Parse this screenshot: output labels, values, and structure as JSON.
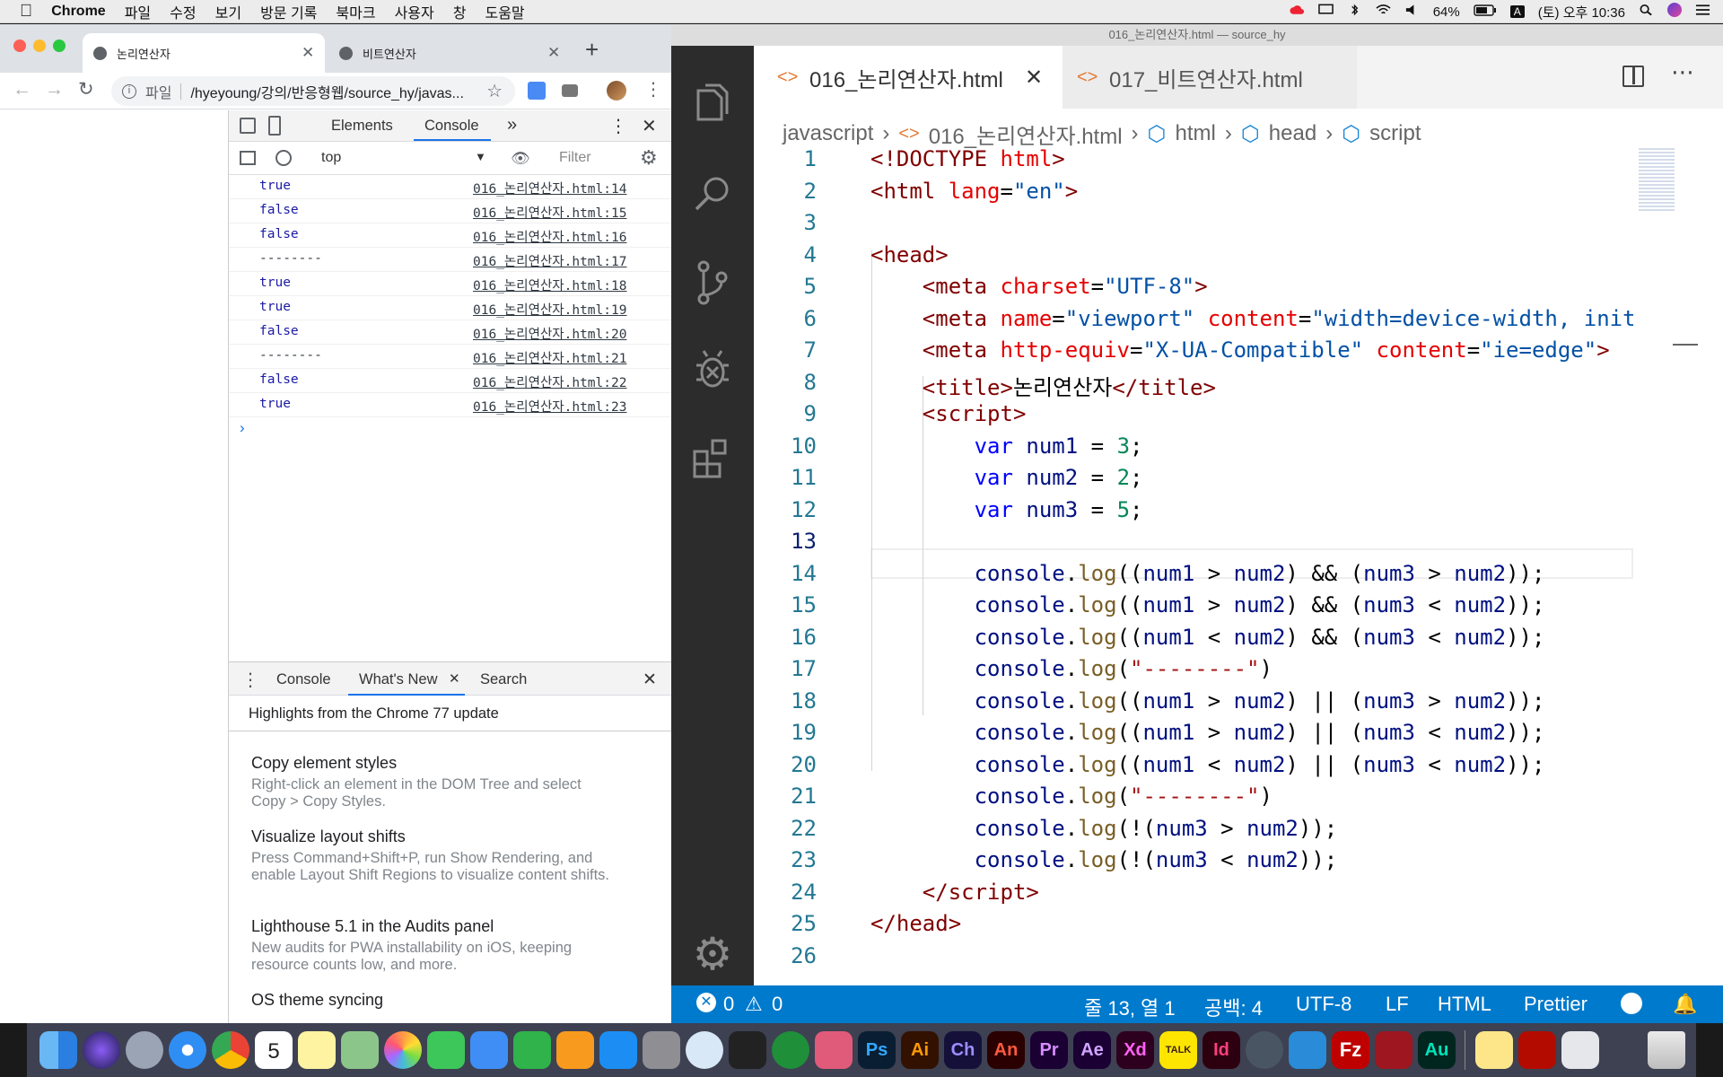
{
  "menubar": {
    "app": "Chrome",
    "items": [
      "파일",
      "수정",
      "보기",
      "방문 기록",
      "북마크",
      "사용자",
      "창",
      "도움말"
    ],
    "battery": "64%",
    "input_source": "A",
    "clock": "(토) 오후 10:36"
  },
  "chrome": {
    "tabs": [
      {
        "title": "논리연산자",
        "active": true
      },
      {
        "title": "비트연산자",
        "active": false
      }
    ],
    "url_prefix": "파일",
    "url": "/hyeyoung/강의/반응형웹/source_hy/javas...",
    "devtools": {
      "panel_tabs": [
        "Elements",
        "Console"
      ],
      "more": "»",
      "context": "top",
      "filter_placeholder": "Filter",
      "console_lines": [
        {
          "value": "true",
          "source": "016_논리연산자.html:14"
        },
        {
          "value": "false",
          "source": "016_논리연산자.html:15"
        },
        {
          "value": "false",
          "source": "016_논리연산자.html:16"
        },
        {
          "value": "--------",
          "source": "016_논리연산자.html:17"
        },
        {
          "value": "true",
          "source": "016_논리연산자.html:18"
        },
        {
          "value": "true",
          "source": "016_논리연산자.html:19"
        },
        {
          "value": "false",
          "source": "016_논리연산자.html:20"
        },
        {
          "value": "--------",
          "source": "016_논리연산자.html:21"
        },
        {
          "value": "false",
          "source": "016_논리연산자.html:22"
        },
        {
          "value": "true",
          "source": "016_논리연산자.html:23"
        }
      ],
      "prompt": "›",
      "drawer_tabs": [
        "Console",
        "What's New",
        "Search"
      ],
      "whats_new_header": "Highlights from the Chrome 77 update",
      "whats_new": [
        {
          "title": "Copy element styles",
          "desc": "Right-click an element in the DOM Tree and select Copy > Copy Styles."
        },
        {
          "title": "Visualize layout shifts",
          "desc": "Press Command+Shift+P, run Show Rendering, and enable Layout Shift Regions to visualize content shifts."
        },
        {
          "title": "Lighthouse 5.1 in the Audits panel",
          "desc": "New audits for PWA installability on iOS, keeping resource counts low, and more."
        },
        {
          "title": "OS theme syncing",
          "desc": ""
        }
      ]
    }
  },
  "vscode": {
    "window_title": "016_논리연산자.html — source_hy",
    "tabs": [
      "016_논리연산자.html",
      "017_비트연산자.html"
    ],
    "breadcrumb": [
      "javascript",
      "016_논리연산자.html",
      "html",
      "head",
      "script"
    ],
    "status": {
      "errors": "0",
      "warnings": "0",
      "position": "줄 13, 열 1",
      "spaces": "공백: 4",
      "encoding": "UTF-8",
      "eol": "LF",
      "language": "HTML",
      "formatter": "Prettier"
    }
  },
  "colors": {
    "vscode_status": "#007acc",
    "activity_bar": "#2c2c2c",
    "console_value": "#1a1aa6"
  }
}
